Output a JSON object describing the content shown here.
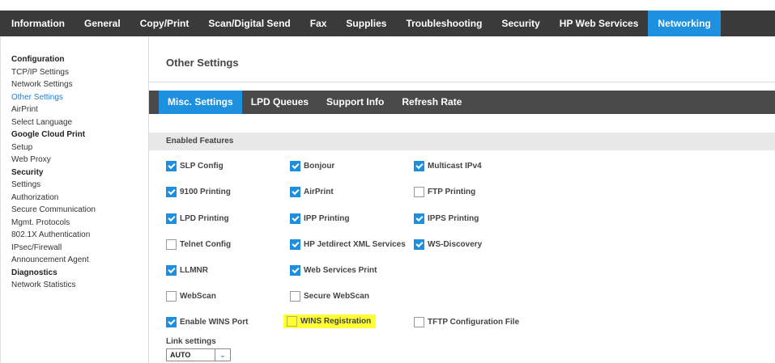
{
  "topnav": {
    "tabs": [
      {
        "label": "Information"
      },
      {
        "label": "General"
      },
      {
        "label": "Copy/Print"
      },
      {
        "label": "Scan/Digital Send"
      },
      {
        "label": "Fax"
      },
      {
        "label": "Supplies"
      },
      {
        "label": "Troubleshooting"
      },
      {
        "label": "Security"
      },
      {
        "label": "HP Web Services"
      },
      {
        "label": "Networking"
      }
    ],
    "active_tab": "Networking"
  },
  "sidebar": {
    "items": [
      {
        "label": "Configuration",
        "type": "section"
      },
      {
        "label": "TCP/IP Settings",
        "type": "link"
      },
      {
        "label": "Network Settings",
        "type": "link"
      },
      {
        "label": "Other Settings",
        "type": "link",
        "active": true
      },
      {
        "label": "AirPrint",
        "type": "link"
      },
      {
        "label": "Select Language",
        "type": "link"
      },
      {
        "label": "Google Cloud Print",
        "type": "section"
      },
      {
        "label": "Setup",
        "type": "link"
      },
      {
        "label": "Web Proxy",
        "type": "link"
      },
      {
        "label": "Security",
        "type": "section"
      },
      {
        "label": "Settings",
        "type": "link"
      },
      {
        "label": "Authorization",
        "type": "link"
      },
      {
        "label": "Secure Communication",
        "type": "link"
      },
      {
        "label": "Mgmt. Protocols",
        "type": "link"
      },
      {
        "label": "802.1X Authentication",
        "type": "link"
      },
      {
        "label": "IPsec/Firewall",
        "type": "link"
      },
      {
        "label": "Announcement Agent",
        "type": "link"
      },
      {
        "label": "Diagnostics",
        "type": "section"
      },
      {
        "label": "Network Statistics",
        "type": "link"
      }
    ]
  },
  "main": {
    "title": "Other Settings",
    "subtabs": [
      {
        "label": "Misc. Settings",
        "active": true
      },
      {
        "label": "LPD Queues"
      },
      {
        "label": "Support Info"
      },
      {
        "label": "Refresh Rate"
      }
    ],
    "enabled_features_header": "Enabled Features",
    "features": [
      {
        "label": "SLP Config",
        "checked": true
      },
      {
        "label": "Bonjour",
        "checked": true
      },
      {
        "label": "Multicast IPv4",
        "checked": true
      },
      {
        "label": "9100 Printing",
        "checked": true
      },
      {
        "label": "AirPrint",
        "checked": true
      },
      {
        "label": "FTP Printing",
        "checked": false
      },
      {
        "label": "LPD Printing",
        "checked": true
      },
      {
        "label": "IPP Printing",
        "checked": true
      },
      {
        "label": "IPPS Printing",
        "checked": true
      },
      {
        "label": "Telnet Config",
        "checked": false
      },
      {
        "label": "HP Jetdirect XML Services",
        "checked": true
      },
      {
        "label": "WS-Discovery",
        "checked": true
      },
      {
        "label": "LLMNR",
        "checked": true
      },
      {
        "label": "Web Services Print",
        "checked": true
      },
      {
        "label": "WebScan",
        "checked": false
      },
      {
        "label": "Secure WebScan",
        "checked": false
      },
      {
        "label": "Enable WINS Port",
        "checked": true
      },
      {
        "label": "WINS Registration",
        "checked": false,
        "highlighted": true
      },
      {
        "label": "TFTP Configuration File",
        "checked": false
      }
    ],
    "link_settings": {
      "label": "Link settings",
      "value": "AUTO"
    }
  },
  "colors": {
    "accent": "#1e90e0",
    "nav_bg": "#3a3a3a",
    "subnav_bg": "#4a4a4a",
    "highlight": "#ffff33"
  }
}
